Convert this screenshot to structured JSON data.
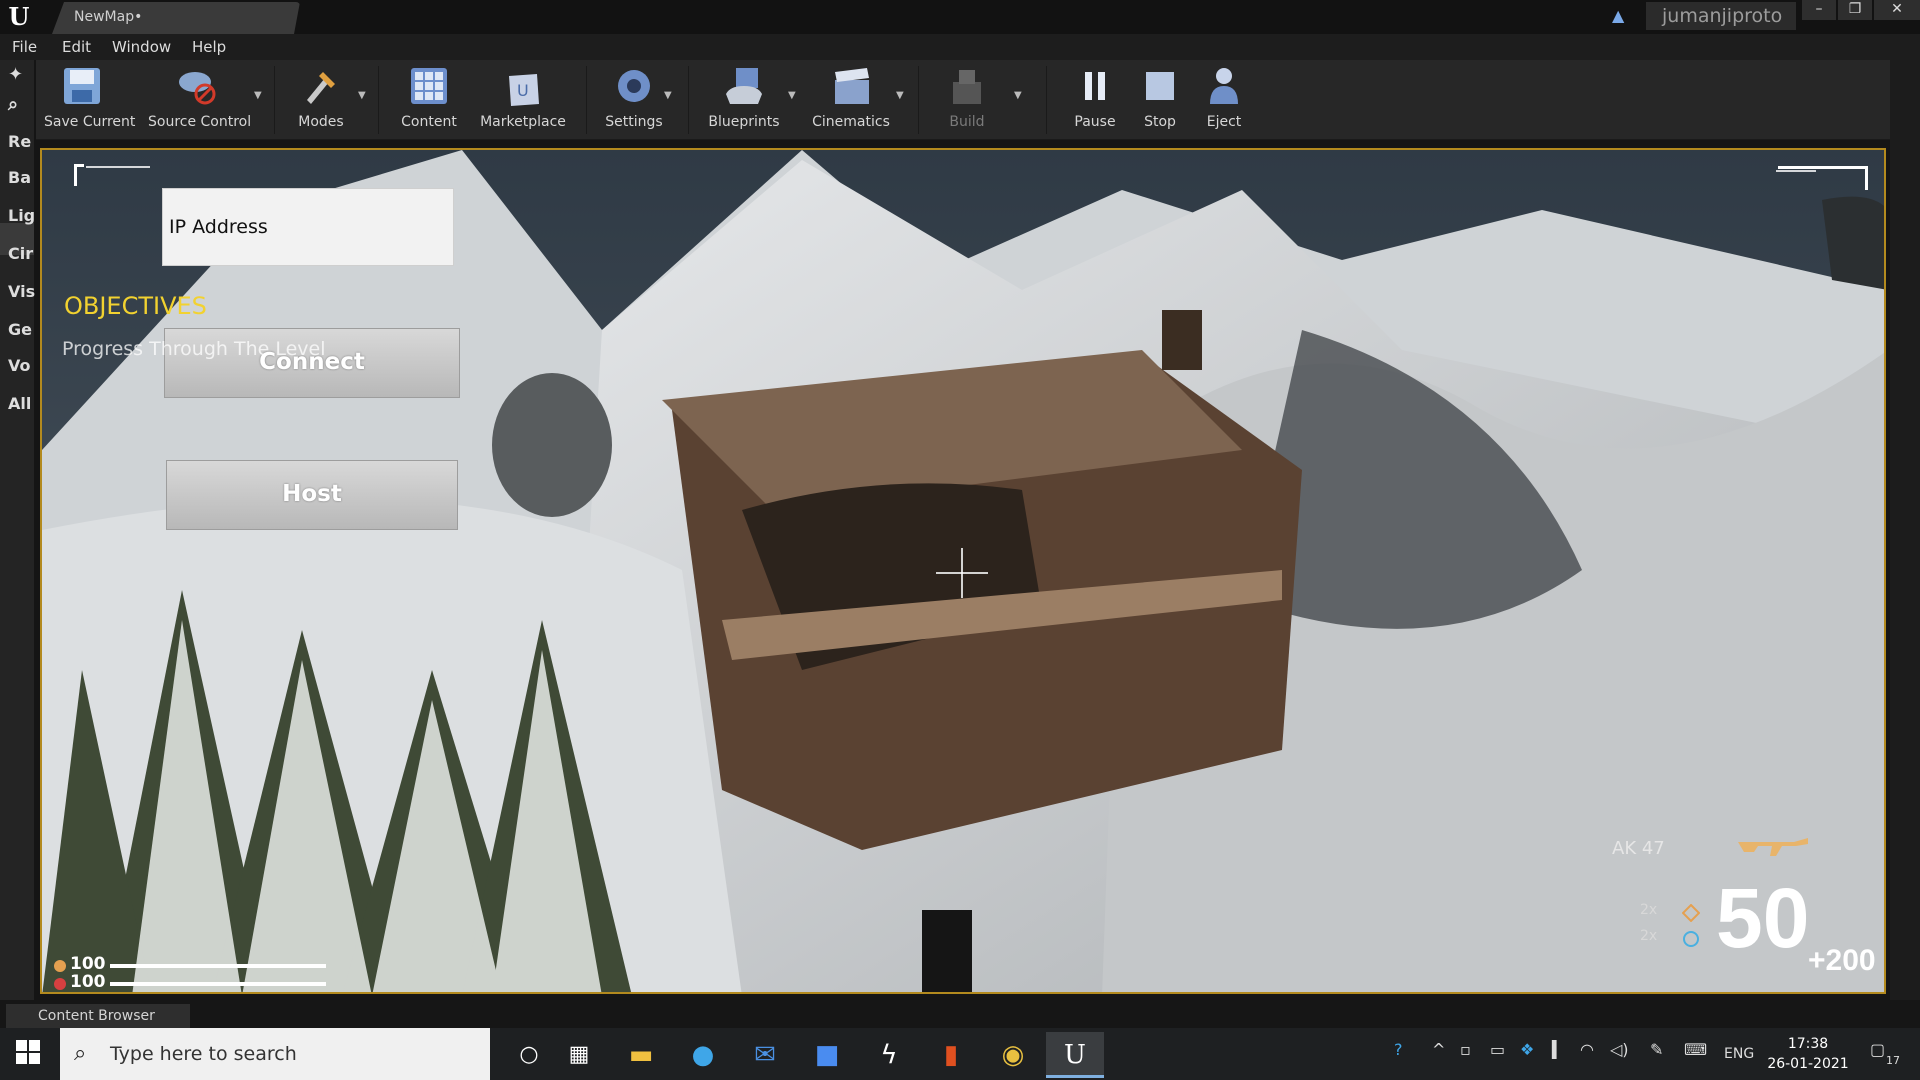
{
  "window": {
    "tab_title": "NewMap•",
    "project_name": "jumanjiproto"
  },
  "menu": [
    "File",
    "Edit",
    "Window",
    "Help"
  ],
  "left_panel": [
    "Re",
    "Ba",
    "Lig",
    "Cir",
    "Vis",
    "Ge",
    "Vo",
    "All"
  ],
  "toolbar": {
    "save_current": "Save Current",
    "source_control": "Source Control",
    "modes": "Modes",
    "content": "Content",
    "marketplace": "Marketplace",
    "settings": "Settings",
    "blueprints": "Blueprints",
    "cinematics": "Cinematics",
    "build": "Build",
    "pause": "Pause",
    "stop": "Stop",
    "eject": "Eject"
  },
  "hud": {
    "ip_placeholder": "IP Address",
    "objectives": "OBJECTIVES",
    "objective_text": "Progress Through The Level",
    "connect": "Connect",
    "host": "Host",
    "weapon": "AK 47",
    "ammo": "50",
    "reserve": "+200",
    "mult1": "2x",
    "mult2": "2x",
    "health": "100",
    "armor": "100",
    "health_fraction": 0.9,
    "armor_fraction": 0.9
  },
  "bottom": {
    "content_browser": "Content Browser"
  },
  "taskbar": {
    "search_placeholder": "Type here to search",
    "language": "ENG",
    "time": "17:38",
    "date": "26-01-2021",
    "notifications": "17"
  },
  "colors": {
    "accent": "#b38a1e",
    "objectives": "#f2d230",
    "editor_bg": "#272727"
  }
}
